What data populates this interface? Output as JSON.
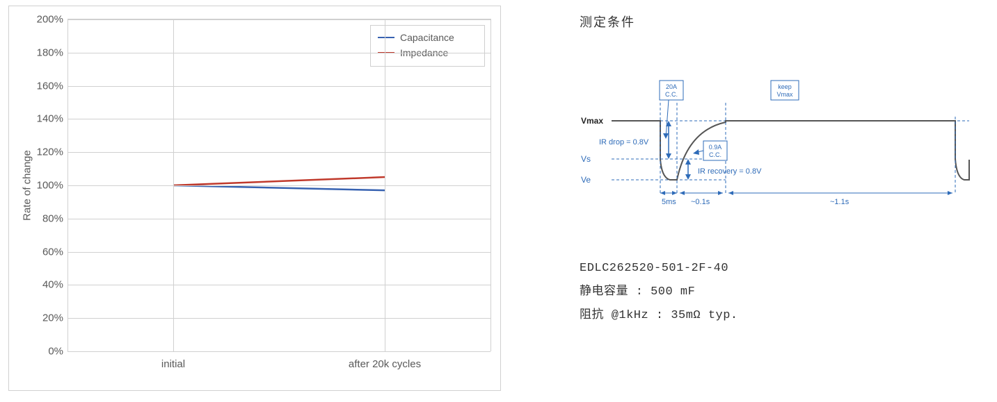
{
  "chart_data": {
    "type": "line",
    "title": "",
    "xlabel": "",
    "ylabel": "Rate of change",
    "categories": [
      "initial",
      "after 20k cycles"
    ],
    "ylim": [
      0,
      200
    ],
    "y_ticks": [
      0,
      20,
      40,
      60,
      80,
      100,
      120,
      140,
      160,
      180,
      200
    ],
    "y_tick_suffix": "%",
    "series": [
      {
        "name": "Capacitance",
        "color": "#3762b1",
        "values": [
          100,
          97
        ]
      },
      {
        "name": "Impedance",
        "color": "#c0392b",
        "values": [
          100,
          105
        ]
      }
    ],
    "legend_position": "top-right",
    "grid": true
  },
  "right": {
    "title": "测定条件",
    "diagram": {
      "vmax_label": "Vmax",
      "vs_label": "Vs",
      "ve_label": "Ve",
      "irdrop_label": "IR drop = 0.8V",
      "irrecovery_label": "IR recovery = 0.8V",
      "box_20a_line1": "20A",
      "box_20a_line2": "C.C.",
      "box_09a_line1": "0.9A",
      "box_09a_line2": "C.C.",
      "box_keep_line1": "keep",
      "box_keep_line2": "Vmax",
      "t_5ms": "5ms",
      "t_01s": "~0.1s",
      "t_11s": "~1.1s"
    },
    "spec": {
      "part_no": "EDLC262520-501-2F-40",
      "cap_label": "静电容量 : 500 mF",
      "imp_label": "阻抗 @1kHz : 35mΩ typ."
    }
  }
}
